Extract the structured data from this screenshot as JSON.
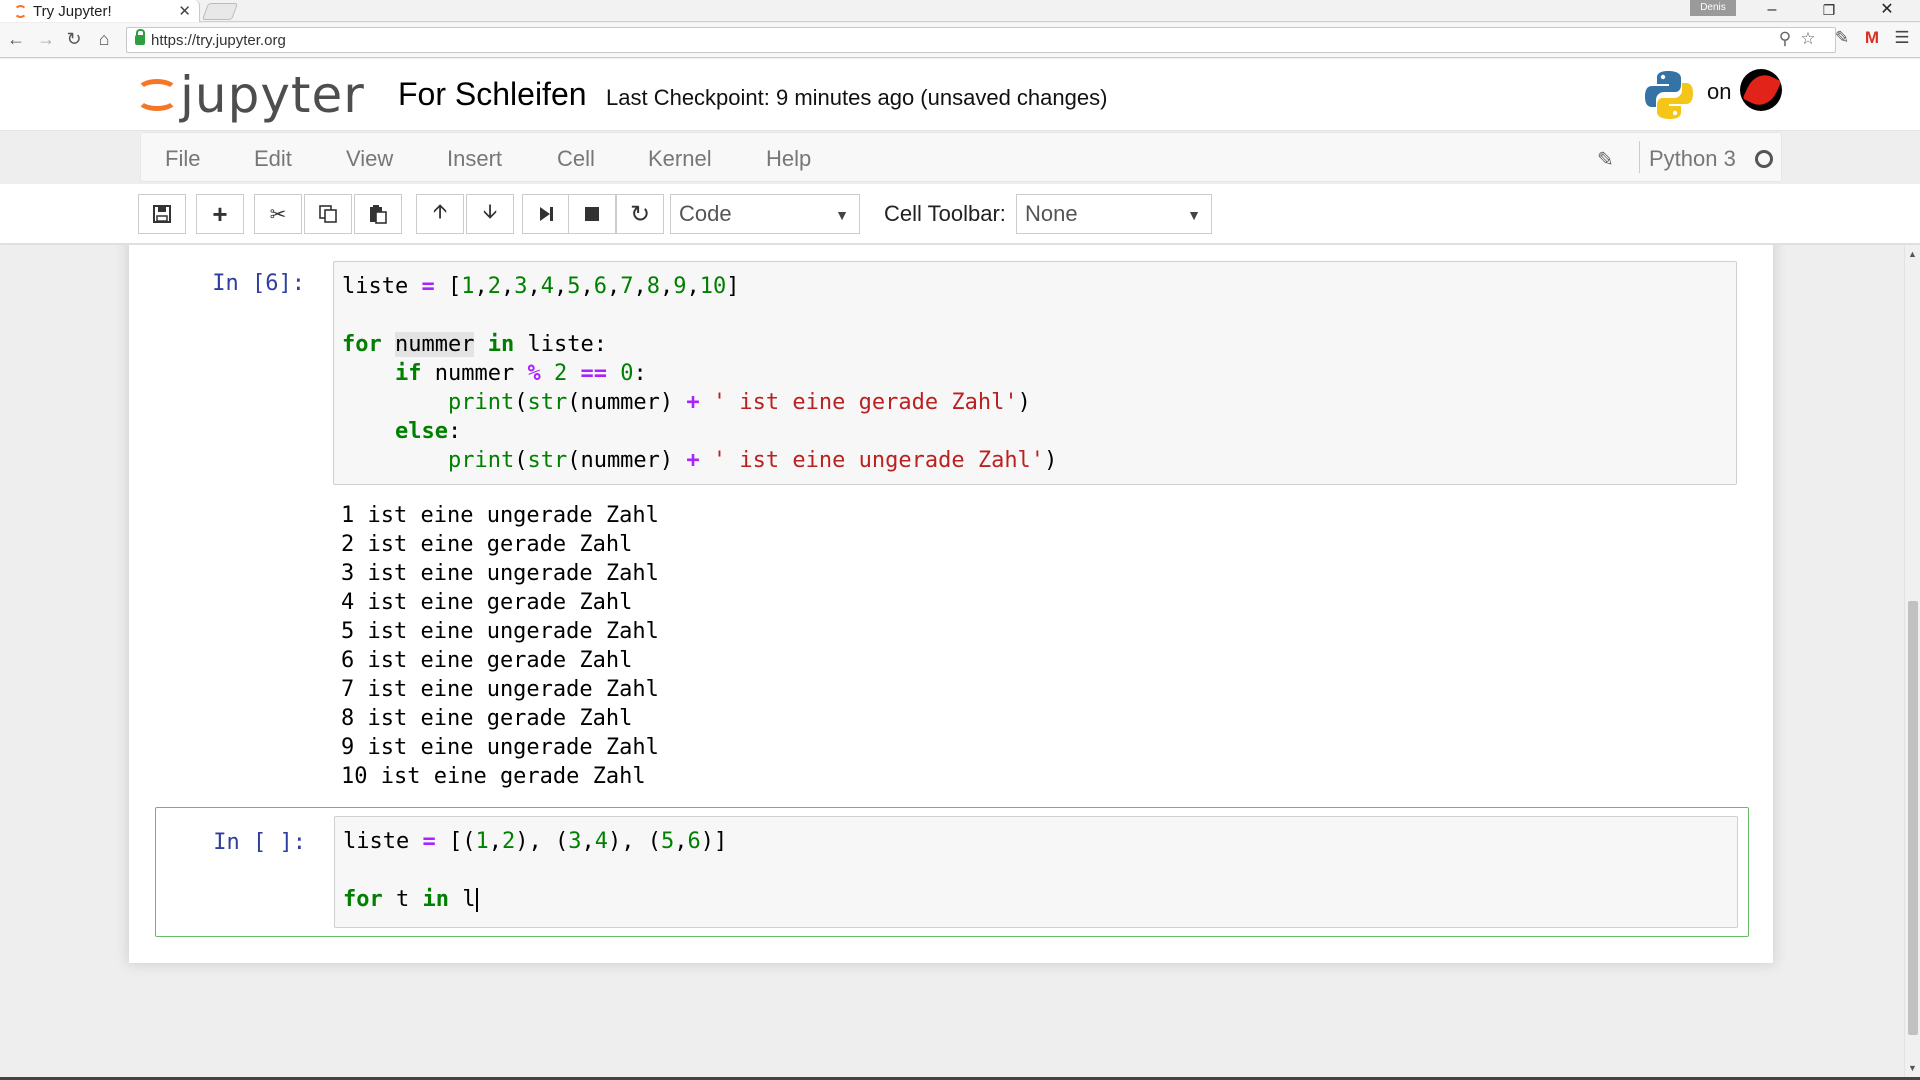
{
  "browser": {
    "tab_title": "Try Jupyter!",
    "tab_close": "✕",
    "user_badge": "Denis",
    "url": "https://try.jupyter.org"
  },
  "header": {
    "logo_text": "jupyter",
    "notebook_name": "For Schleifen",
    "checkpoint": "Last Checkpoint: 9 minutes ago (unsaved changes)",
    "on_text": "on"
  },
  "menubar": {
    "items": [
      "File",
      "Edit",
      "View",
      "Insert",
      "Cell",
      "Kernel",
      "Help"
    ],
    "kernel_name": "Python 3"
  },
  "toolbar": {
    "cell_type": "Code",
    "cell_toolbar_label": "Cell Toolbar:",
    "cell_toolbar_value": "None"
  },
  "cells": [
    {
      "prompt": "In [6]:",
      "code": [
        "liste = [1,2,3,4,5,6,7,8,9,10]",
        "",
        "for nummer in liste:",
        "    if nummer % 2 == 0:",
        "        print(str(nummer) + ' ist eine gerade Zahl')",
        "    else:",
        "        print(str(nummer) + ' ist eine ungerade Zahl')"
      ],
      "output": [
        "1 ist eine ungerade Zahl",
        "2 ist eine gerade Zahl",
        "3 ist eine ungerade Zahl",
        "4 ist eine gerade Zahl",
        "5 ist eine ungerade Zahl",
        "6 ist eine gerade Zahl",
        "7 ist eine ungerade Zahl",
        "8 ist eine gerade Zahl",
        "9 ist eine ungerade Zahl",
        "10 ist eine gerade Zahl"
      ]
    },
    {
      "prompt": "In [ ]:",
      "code": [
        "liste = [(1,2), (3,4), (5,6)]",
        "",
        "for t in l"
      ]
    }
  ],
  "colors": {
    "jupyter_orange": "#f37726",
    "prompt_blue": "#303f9f",
    "keyword_green": "#008000",
    "operator_purple": "#aa22ff",
    "string_red": "#ba2121",
    "selected_border": "#66bb6a"
  }
}
